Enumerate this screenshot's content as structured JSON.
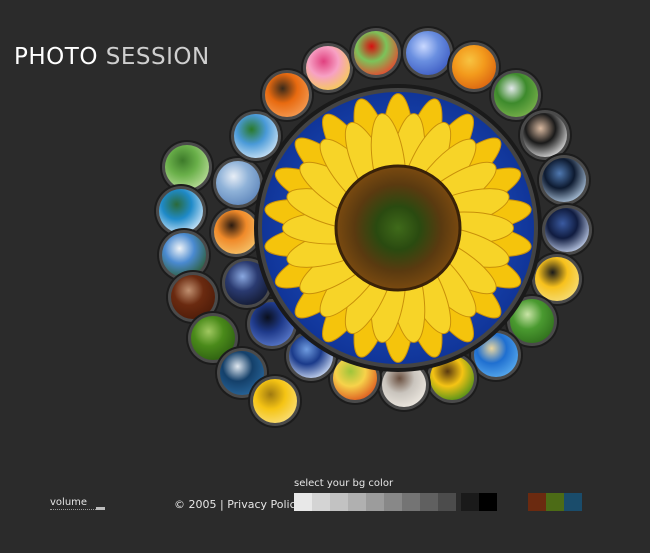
{
  "header": {
    "title_word1": "PHOTO",
    "title_word2": "SESSION"
  },
  "gallery": {
    "main_photo": "sunflower",
    "thumbnails": [
      "pink-flower",
      "red-tulip",
      "blue-flower",
      "orange-lilies",
      "garden-trees",
      "woman-portrait",
      "night-city",
      "bridge-night",
      "butterfly",
      "green-field",
      "beach",
      "sunflower-small",
      "couple-reading",
      "fruit-basket",
      "ocean-wave",
      "tree-silhouette",
      "city-skyline",
      "sunset-sea",
      "cloudy-sky",
      "palm-trees",
      "orange-text-panel",
      "park-landscape",
      "coastline",
      "lighthouse",
      "brown-text-panel",
      "green-text-panel",
      "contacts-form",
      "yellow-text-panel"
    ]
  },
  "footer": {
    "volume_label": "volume",
    "copyright": "© 2005 |",
    "privacy_label": "Privacy Policy",
    "bg_color_label": "select your bg color"
  },
  "bg_swatches": [
    "#e8e8e8",
    "#d4d4d4",
    "#c2c2c2",
    "#b0b0b0",
    "#9c9c9c",
    "#888888",
    "#747474",
    "#606060",
    "#4c4c4c",
    "#1a1a1a",
    "#000000",
    "#6b2a10",
    "#4c6b16",
    "#1a4c6b"
  ],
  "colors": {
    "background": "#2b2b2b",
    "ring": "#3a3a3a"
  }
}
